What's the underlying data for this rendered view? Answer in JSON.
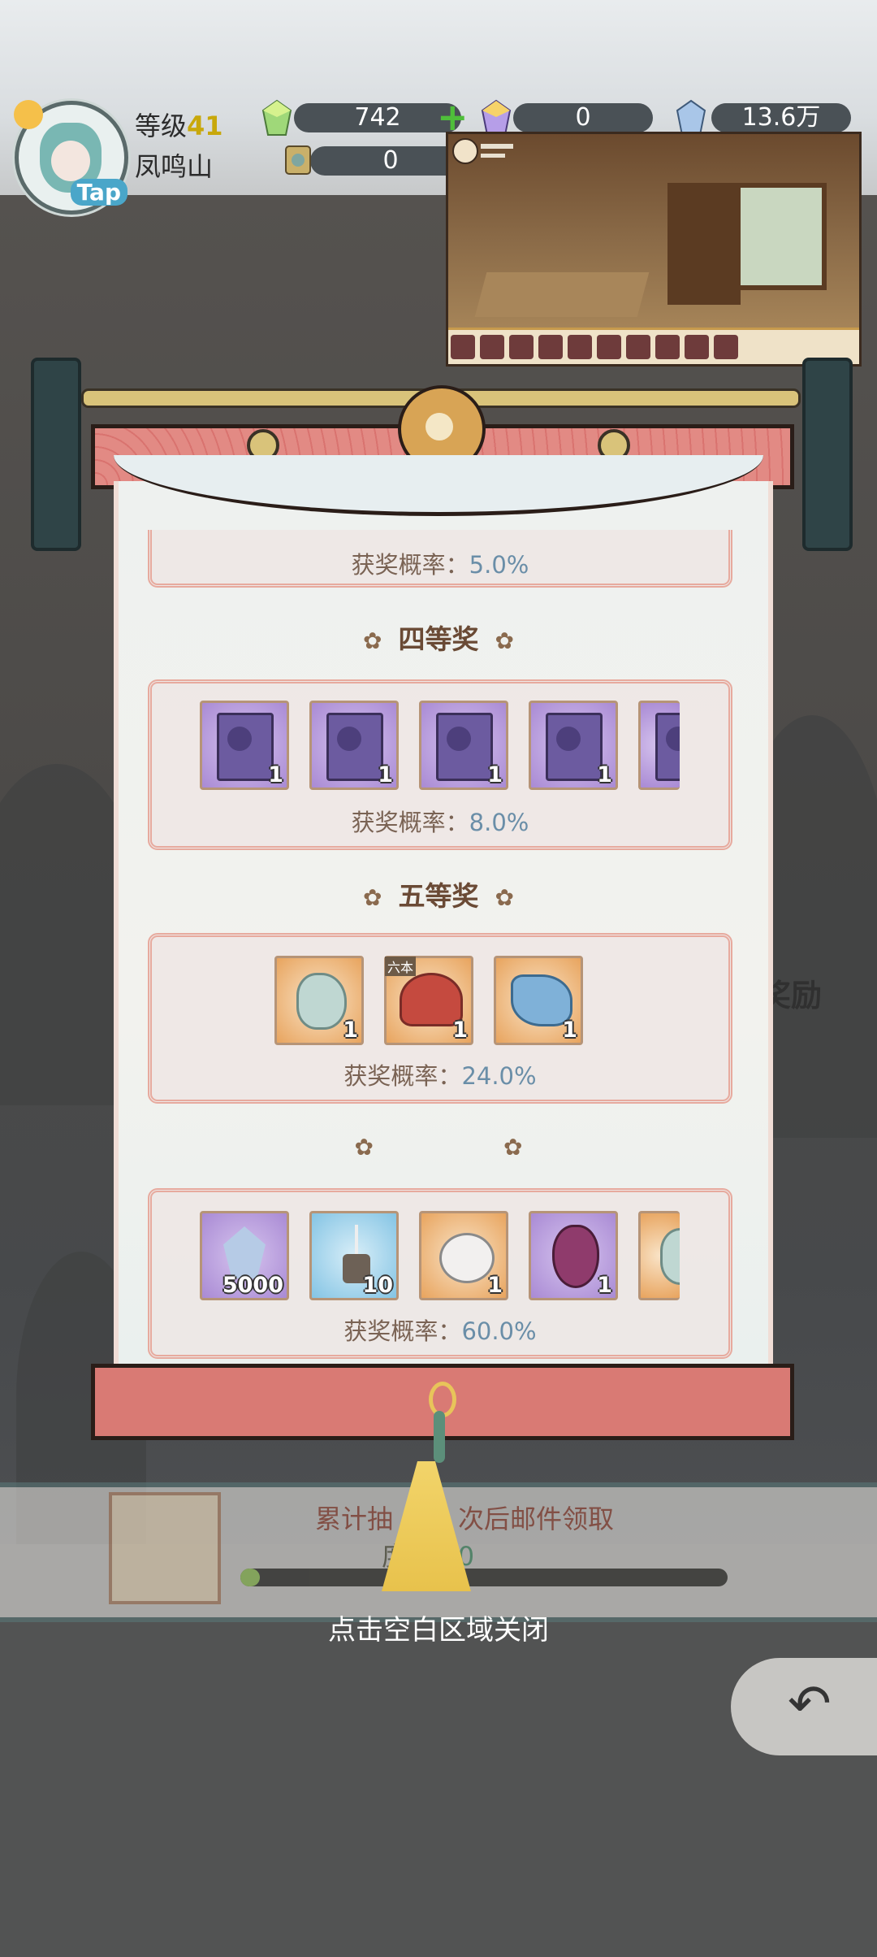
{
  "hud": {
    "level_label": "等级",
    "level": "41",
    "place": "凤鸣山",
    "avatar_tap": "Tap",
    "jade": "742",
    "rainbow": "0",
    "crystal": "13.6万",
    "coupon": "0"
  },
  "prize_pool": {
    "rate_label": "获奖概率：",
    "tier3": {
      "rate": "5.0%"
    },
    "tier4": {
      "title": "四等奖",
      "rate": "8.0%",
      "items": [
        {
          "icon": "purple-book-icon",
          "count": "1"
        },
        {
          "icon": "purple-book-icon",
          "count": "1"
        },
        {
          "icon": "purple-book-icon",
          "count": "1"
        },
        {
          "icon": "purple-book-icon",
          "count": "1"
        }
      ]
    },
    "tier5": {
      "title": "五等奖",
      "rate": "24.0%",
      "items": [
        {
          "icon": "jade-stone-icon",
          "count": "1"
        },
        {
          "icon": "helmet-icon",
          "count": "1",
          "tag": "六本"
        },
        {
          "icon": "silk-cloth-icon",
          "count": "1"
        }
      ]
    },
    "tier6": {
      "title": "",
      "rate": "60.0%",
      "items": [
        {
          "icon": "crystal-icon",
          "count": "5000"
        },
        {
          "icon": "incense-icon",
          "count": "10"
        },
        {
          "icon": "cloth-sack-icon",
          "count": "1"
        },
        {
          "icon": "gourd-icon",
          "count": "1"
        }
      ]
    }
  },
  "cumulative": {
    "text": "累计抽",
    "text2": "次后邮件领取",
    "progress_label": "度",
    "progress_value": "2/50",
    "progress_fraction": 0.04
  },
  "side_reward": "奖励",
  "close_hint": "点击空白区域关闭",
  "colors": {
    "accent_red": "#d97a74",
    "teal": "#2f4447",
    "gold": "#d9c37a"
  }
}
